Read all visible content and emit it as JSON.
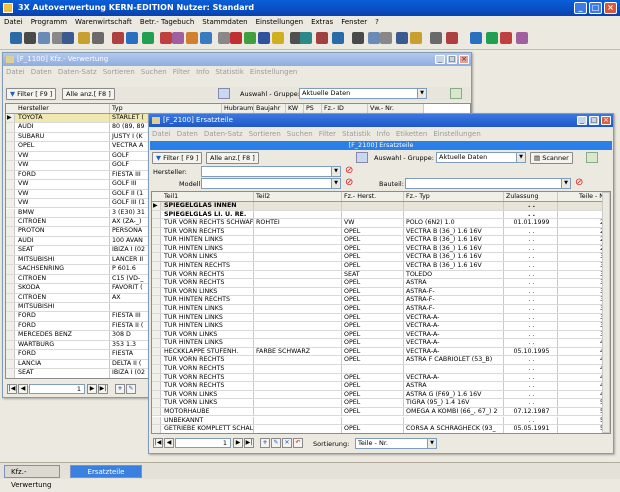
{
  "app": {
    "title": "3X Autoverwertung KERN-EDITION Nutzer: Standard",
    "menu": [
      "Datei",
      "Programm",
      "Warenwirtschaft",
      "Betr.- Tagebuch",
      "Stammdaten",
      "Einstellungen",
      "Extras",
      "Fenster",
      "?"
    ]
  },
  "taskbar": {
    "items": [
      "Kfz.- Verwertung",
      "Ersatzteile"
    ]
  },
  "kfz": {
    "title": "[F_1100] Kfz.- Verwertung",
    "menu": [
      "Datei",
      "Daten",
      "Daten-Satz",
      "Sortieren",
      "Suchen",
      "Filter",
      "Info",
      "Statistik",
      "Einstellungen"
    ],
    "filter_btn": "Filter [ F9 ]",
    "all_btn": "Alle anz.[ F8 ]",
    "group_label": "Auswahl - Gruppe:",
    "group_value": "Aktuelle Daten",
    "columns": [
      "Hersteller",
      "Typ",
      "Hubraum",
      "Baujahr",
      "KW",
      "PS",
      "Fz.- ID",
      "Vw.- Nr."
    ],
    "rows": [
      {
        "h": "TOYOTA",
        "t": "STARLET ("
      },
      {
        "h": "AUDI",
        "t": "80 (89, 89"
      },
      {
        "h": "SUBARU",
        "t": "JUSTY I (K"
      },
      {
        "h": "OPEL",
        "t": "VECTRA A"
      },
      {
        "h": "VW",
        "t": "GOLF"
      },
      {
        "h": "VW",
        "t": "GOLF"
      },
      {
        "h": "FORD",
        "t": "FIESTA III"
      },
      {
        "h": "VW",
        "t": "GOLF III"
      },
      {
        "h": "VW",
        "t": "GOLF II (1"
      },
      {
        "h": "VW",
        "t": "GOLF III (1"
      },
      {
        "h": "BMW",
        "t": "3 (E30) 31"
      },
      {
        "h": "CITROEN",
        "t": "AX (ZA-_)"
      },
      {
        "h": "PROTON",
        "t": "PERSONA"
      },
      {
        "h": "AUDI",
        "t": "100 AVAN"
      },
      {
        "h": "SEAT",
        "t": "IBIZA I (02"
      },
      {
        "h": "MITSUBISHI",
        "t": "LANCER II"
      },
      {
        "h": "SACHSENRING",
        "t": "P 601.6"
      },
      {
        "h": "CITROEN",
        "t": "C15 (VD-_"
      },
      {
        "h": "SKODA",
        "t": "FAVORIT ("
      },
      {
        "h": "CITROEN",
        "t": "AX"
      },
      {
        "h": "MITSUBISHI",
        "t": ""
      },
      {
        "h": "FORD",
        "t": "FIESTA III"
      },
      {
        "h": "FORD",
        "t": "FIESTA II ("
      },
      {
        "h": "MERCEDES BENZ",
        "t": "308 D"
      },
      {
        "h": "WARTBURG",
        "t": "353 1.3"
      },
      {
        "h": "FORD",
        "t": "FIESTA"
      },
      {
        "h": "LANCIA",
        "t": "DELTA II ("
      },
      {
        "h": "SEAT",
        "t": "IBIZA I (02"
      }
    ],
    "nav_pos": "1"
  },
  "ers": {
    "title": "[F_2100] Ersatzteile",
    "menu": [
      "Datei",
      "Daten",
      "Daten-Satz",
      "Sortieren",
      "Suchen",
      "Filter",
      "Statistik",
      "Info",
      "Etiketten",
      "Einstellungen"
    ],
    "header_banner": "[F_2100] Ersatzteile",
    "filter_btn": "Filter [ F9 ]",
    "all_btn": "Alle anz.[ F8 ]",
    "group_label": "Auswahl - Gruppe:",
    "group_value": "Aktuelle Daten",
    "scanner_btn": "Scanner",
    "hersteller_label": "Hersteller:",
    "modell_label": "Modell:",
    "bauteil_label": "Bauteil:",
    "columns": [
      "Teil1",
      "Teil2",
      "Fz.- Herst.",
      "Fz.- Typ",
      "Zulassung",
      "Teile - Nr."
    ],
    "rows": [
      {
        "t1": "SPIEGELGLAS INNEN",
        "t2": "",
        "h": "",
        "ty": "",
        "z": ". .",
        "n": "1",
        "grp": true
      },
      {
        "t1": "SPIEGELGLAS LI. U. RE.",
        "t2": "",
        "h": "",
        "ty": "",
        "z": ". .",
        "n": "2"
      },
      {
        "t1": "TUR VORN RECHTS SCHWAF",
        "t2": "ROHTEI",
        "h": "VW",
        "ty": "POLO (6N2) 1.0",
        "z": "01.01.1999",
        "n": "26"
      },
      {
        "t1": "TUR VORN RECHTS",
        "t2": "",
        "h": "OPEL",
        "ty": "VECTRA B (36_) 1.6 16V",
        "z": ". .",
        "n": "27"
      },
      {
        "t1": "TUR HINTEN LINKS",
        "t2": "",
        "h": "OPEL",
        "ty": "VECTRA B (36_) 1.6 16V",
        "z": ". .",
        "n": "28"
      },
      {
        "t1": "TUR HINTEN LINKS",
        "t2": "",
        "h": "OPEL",
        "ty": "VECTRA B (36_) 1.6 16V",
        "z": ". .",
        "n": "29"
      },
      {
        "t1": "TUR VORN LINKS",
        "t2": "",
        "h": "OPEL",
        "ty": "VECTRA B (36_) 1.6 16V",
        "z": ". .",
        "n": "30"
      },
      {
        "t1": "TUR HINTEN RECHTS",
        "t2": "",
        "h": "OPEL",
        "ty": "VECTRA B (36_) 1.6 16V",
        "z": ". .",
        "n": "31"
      },
      {
        "t1": "TUR VORN RECHTS",
        "t2": "",
        "h": "SEAT",
        "ty": "TOLEDO",
        "z": ". .",
        "n": "32"
      },
      {
        "t1": "TUR VORN RECHTS",
        "t2": "",
        "h": "OPEL",
        "ty": "ASTRA",
        "z": ". .",
        "n": "33"
      },
      {
        "t1": "TUR VORN LINKS",
        "t2": "",
        "h": "OPEL",
        "ty": "ASTRA-F-",
        "z": ". .",
        "n": "34"
      },
      {
        "t1": "TUR HINTEN RECHTS",
        "t2": "",
        "h": "OPEL",
        "ty": "ASTRA-F-",
        "z": ". .",
        "n": "35"
      },
      {
        "t1": "TUR HINTEN LINKS",
        "t2": "",
        "h": "OPEL",
        "ty": "ASTRA-F-",
        "z": ". .",
        "n": "36"
      },
      {
        "t1": "TUR HINTEN LINKS",
        "t2": "",
        "h": "OPEL",
        "ty": "VECTRA-A-",
        "z": ". .",
        "n": "37"
      },
      {
        "t1": "TUR HINTEN LINKS",
        "t2": "",
        "h": "OPEL",
        "ty": "VECTRA-A-",
        "z": ". .",
        "n": "38"
      },
      {
        "t1": "TUR VORN LINKS",
        "t2": "",
        "h": "OPEL",
        "ty": "VECTRA-A-",
        "z": ". .",
        "n": "39"
      },
      {
        "t1": "TUR HINTEN LINKS",
        "t2": "",
        "h": "OPEL",
        "ty": "VECTRA-A-",
        "z": ". .",
        "n": "40"
      },
      {
        "t1": "HECKKLAPPE STUFENH.",
        "t2": "FARBE SCHWARZ",
        "h": "OPEL",
        "ty": "VECTRA-A-",
        "z": "05.10.1995",
        "n": "41"
      },
      {
        "t1": "TUR VORN RECHTS",
        "t2": "",
        "h": "OPEL",
        "ty": "ASTRA F CABRIOLET (53_B)",
        "z": ". .",
        "n": "44"
      },
      {
        "t1": "TUR VORN RECHTS",
        "t2": "",
        "h": "",
        "ty": "",
        "z": ". .",
        "n": "45"
      },
      {
        "t1": "TUR VORN RECHTS",
        "t2": "",
        "h": "OPEL",
        "ty": "VECTRA-A-",
        "z": ". .",
        "n": "46"
      },
      {
        "t1": "TUR VORN RECHTS",
        "t2": "",
        "h": "OPEL",
        "ty": "ASTRA",
        "z": ". .",
        "n": "48"
      },
      {
        "t1": "TUR VORN LINKS",
        "t2": "",
        "h": "OPEL",
        "ty": "ASTRA G (F69_) 1.6 16V",
        "z": ". .",
        "n": "49"
      },
      {
        "t1": "TUR VORN LINKS",
        "t2": "",
        "h": "OPEL",
        "ty": "TIGRA (95_) 1.4 16V",
        "z": ". .",
        "n": "50"
      },
      {
        "t1": "MOTORHAUBE",
        "t2": "",
        "h": "OPEL",
        "ty": "OMEGA A KOMBI (66_, 67_) 2",
        "z": "07.12.1987",
        "n": "51"
      },
      {
        "t1": "UNBEKANNT",
        "t2": "",
        "h": "",
        "ty": "",
        "z": ". .",
        "n": "52"
      },
      {
        "t1": "GETRIEBE KOMPLETT SCHAL",
        "t2": "",
        "h": "OPEL",
        "ty": "CORSA A SCHRÄGHECK (93_",
        "z": "05.05.1991",
        "n": "54"
      }
    ],
    "nav_pos": "1",
    "sort_label": "Sortierung:",
    "sort_value": "Teile - Nr."
  },
  "colors": {
    "titlebar": "#0a5fd8",
    "active_win": "#2a68d8",
    "inactive_win": "#9db4e0",
    "banner": "#2a7fe8",
    "selected_row": "#f0e8b0"
  }
}
